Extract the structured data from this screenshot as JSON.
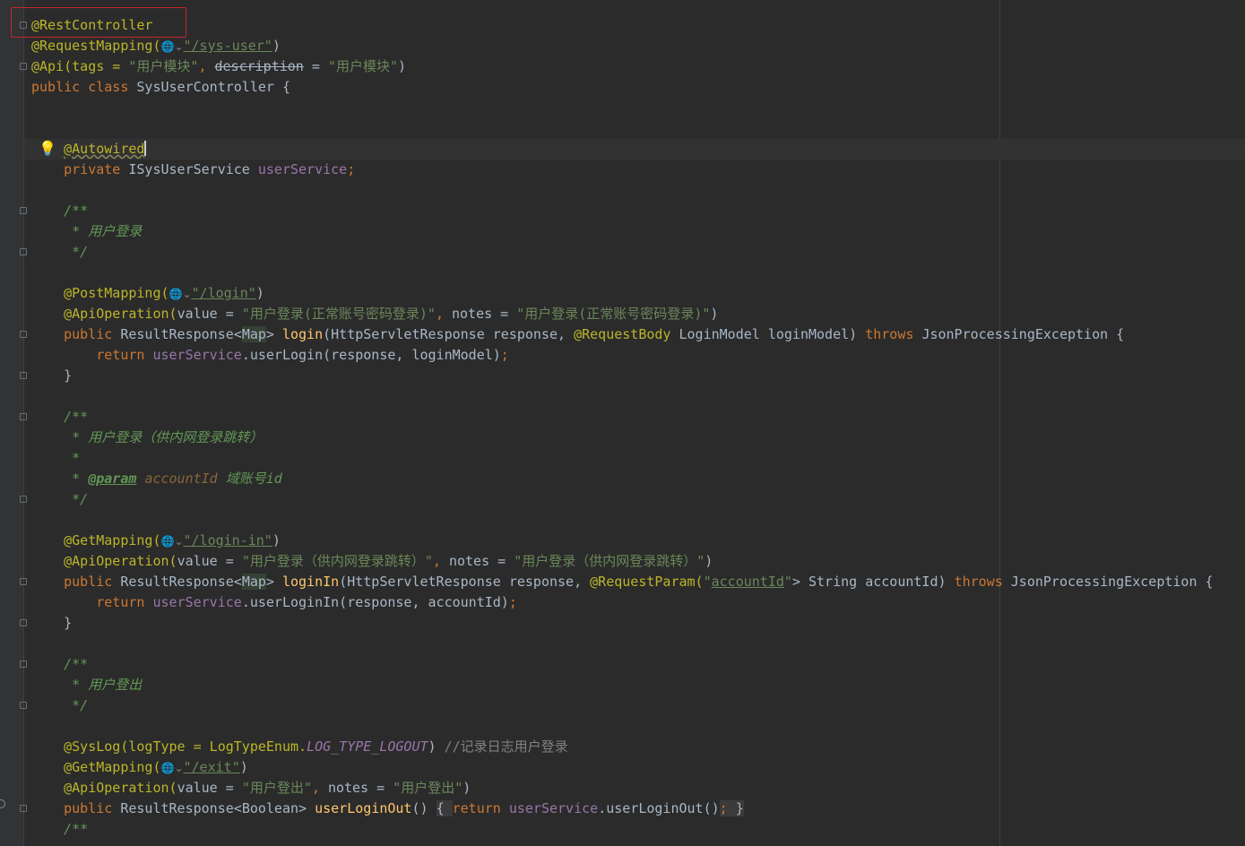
{
  "lines": [
    "@RestController",
    "@RequestMapping(",
    "\"/sys-user\"",
    ")",
    "@Api(tags = ",
    "\"用户模块\"",
    ", ",
    "description",
    " = ",
    ")",
    "public class ",
    "SysUserController {",
    "@Autowired",
    "private ",
    "ISysUserService ",
    "userService",
    ";",
    "/**",
    " * 用户登录",
    " */",
    "@PostMapping(",
    "\"/login\"",
    "@ApiOperation(",
    "value = ",
    "\"用户登录(正常账号密码登录)\"",
    "notes = ",
    "public ",
    "ResultResponse<",
    "Map",
    "> ",
    "login",
    "(HttpServletResponse response, ",
    "@RequestBody ",
    "LoginModel loginModel) ",
    "throws ",
    "JsonProcessingException {",
    "return ",
    ".userLogin(response, loginModel)",
    "}",
    " * 用户登录（供内网登录跳转）",
    " *",
    " * ",
    "@param",
    "accountId",
    " 域账号id",
    "@GetMapping(",
    "\"/login-in\"",
    "\"用户登录（供内网登录跳转）\"",
    "loginIn",
    "@RequestParam(",
    "\"",
    "\" ",
    "String accountId) ",
    ".userLoginIn(response, accountId)",
    " * 用户登出",
    "@SysLog(logType = LogTypeEnum.",
    "LOG_TYPE_LOGOUT",
    ") ",
    "//记录日志用户登录",
    "\"/exit\"",
    "\"用户登出\"",
    "Boolean",
    "userLoginOut",
    "() ",
    "{ ",
    ".userLoginOut()",
    "; ",
    "/**"
  ],
  "icons": {
    "lightbulb": "lightbulb-icon",
    "globe": "globe-dropdown-icon",
    "fold": "fold-marker-icon"
  },
  "colors": {
    "background": "#2b2b2b",
    "keyword": "#cc7832",
    "annotation": "#bbb529",
    "string": "#6a8759",
    "field": "#9876aa",
    "method": "#ffc66d",
    "doc_comment": "#629755",
    "highlight_box": "#c4282b"
  }
}
